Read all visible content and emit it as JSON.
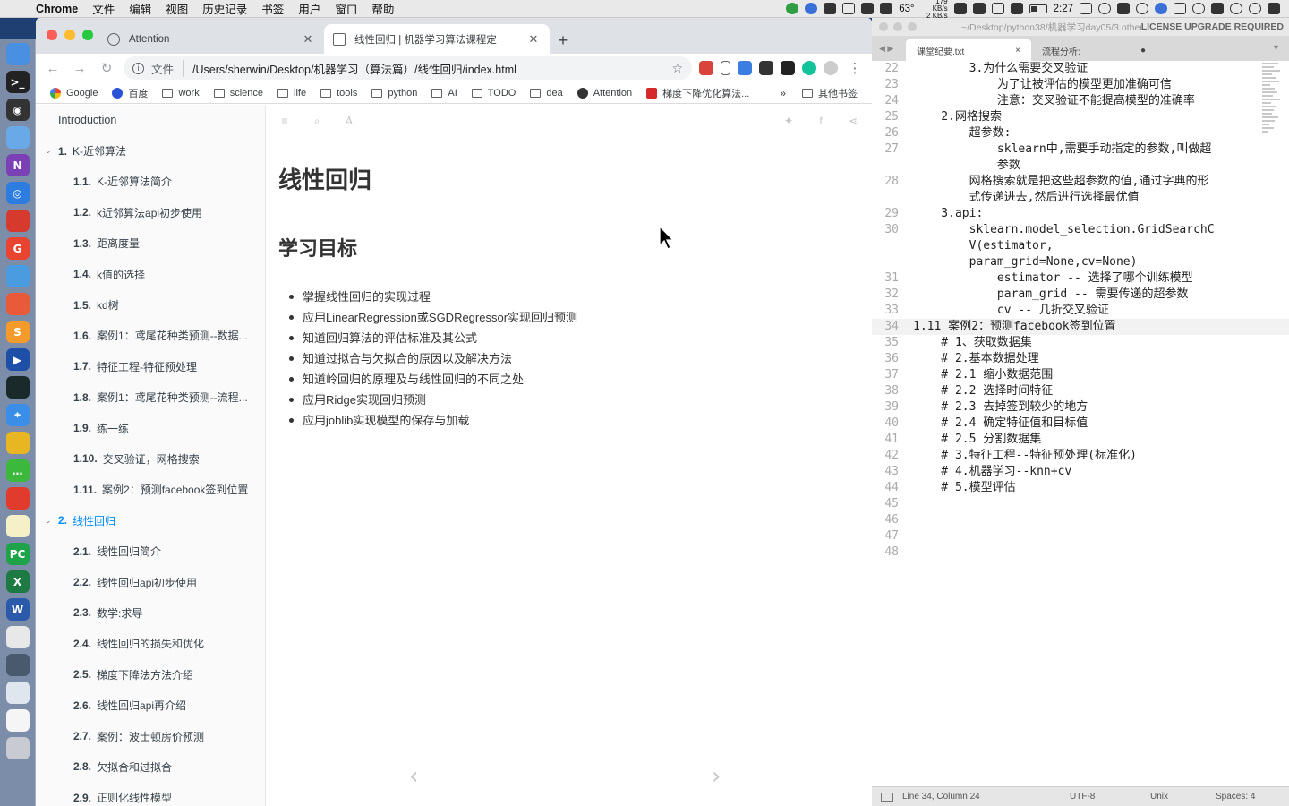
{
  "menubar": {
    "app_name": "Chrome",
    "items": [
      "文件",
      "编辑",
      "视图",
      "历史记录",
      "书签",
      "用户",
      "窗口",
      "帮助"
    ],
    "temperature": "63°",
    "net_up": "179 KB/s",
    "net_down": "2 KB/s",
    "clock": "2:27"
  },
  "chrome": {
    "tabs": [
      {
        "title": "Attention",
        "active": false
      },
      {
        "title": "线性回归 | 机器学习算法课程定",
        "active": true
      }
    ],
    "address": {
      "scheme_label": "文件",
      "url": "/Users/sherwin/Desktop/机器学习（算法篇）/线性回归/index.html"
    },
    "bookmarks": [
      "Google",
      "百度",
      "work",
      "science",
      "life",
      "tools",
      "python",
      "AI",
      "TODO",
      "dea",
      "Attention",
      "梯度下降优化算法..."
    ],
    "bookmarks_more": "»",
    "other_bookmarks": "其他书签"
  },
  "summary": {
    "intro": "Introduction",
    "chapters": [
      {
        "num": "1.",
        "title": "K-近邻算法",
        "active": false,
        "items": [
          {
            "num": "1.1.",
            "title": "K-近邻算法简介"
          },
          {
            "num": "1.2.",
            "title": "k近邻算法api初步使用"
          },
          {
            "num": "1.3.",
            "title": "距离度量"
          },
          {
            "num": "1.4.",
            "title": "k值的选择"
          },
          {
            "num": "1.5.",
            "title": "kd树"
          },
          {
            "num": "1.6.",
            "title": "案例1：鸢尾花种类预测--数据..."
          },
          {
            "num": "1.7.",
            "title": "特征工程-特征预处理"
          },
          {
            "num": "1.8.",
            "title": "案例1：鸢尾花种类预测--流程..."
          },
          {
            "num": "1.9.",
            "title": "练一练"
          },
          {
            "num": "1.10.",
            "title": "交叉验证，网格搜索"
          },
          {
            "num": "1.11.",
            "title": "案例2：预测facebook签到位置"
          }
        ]
      },
      {
        "num": "2.",
        "title": "线性回归",
        "active": true,
        "items": [
          {
            "num": "2.1.",
            "title": "线性回归简介"
          },
          {
            "num": "2.2.",
            "title": "线性回归api初步使用"
          },
          {
            "num": "2.3.",
            "title": "数学:求导"
          },
          {
            "num": "2.4.",
            "title": "线性回归的损失和优化"
          },
          {
            "num": "2.5.",
            "title": "梯度下降法方法介绍"
          },
          {
            "num": "2.6.",
            "title": "线性回归api再介绍"
          },
          {
            "num": "2.7.",
            "title": "案例：波士顿房价预测"
          },
          {
            "num": "2.8.",
            "title": "欠拟合和过拟合"
          },
          {
            "num": "2.9.",
            "title": "正则化线性模型"
          }
        ]
      }
    ]
  },
  "content": {
    "title": "线性回归",
    "section": "学习目标",
    "objectives": [
      "掌握线性回归的实现过程",
      "应用LinearRegression或SGDRegressor实现回归预测",
      "知道回归算法的评估标准及其公式",
      "知道过拟合与欠拟合的原因以及解决方法",
      "知道岭回归的原理及与线性回归的不同之处",
      "应用Ridge实现回归预测",
      "应用joblib实现模型的保存与加载"
    ],
    "prev_arrow": "‹",
    "next_arrow": "›"
  },
  "sublime": {
    "title_path": "~/Desktop/python38/机器学习day05/3.other",
    "license": "LICENSE UPGRADE REQUIRED",
    "tabs": [
      {
        "name": "课堂纪要.txt",
        "active": true,
        "close": "×"
      },
      {
        "name": "流程分析:",
        "active": false,
        "close": "●"
      }
    ],
    "lines": [
      {
        "n": "22",
        "t": "        3.为什么需要交叉验证"
      },
      {
        "n": "23",
        "t": "            为了让被评估的模型更加准确可信"
      },
      {
        "n": "24",
        "t": "            注意：交叉验证不能提高模型的准确率"
      },
      {
        "n": "25",
        "t": "    2.网格搜索"
      },
      {
        "n": "26",
        "t": "        超参数:"
      },
      {
        "n": "27",
        "t": "            sklearn中,需要手动指定的参数,叫做超"
      },
      {
        "n": "",
        "t": "            参数"
      },
      {
        "n": "28",
        "t": "        网格搜索就是把这些超参数的值,通过字典的形"
      },
      {
        "n": "",
        "t": "        式传递进去,然后进行选择最优值"
      },
      {
        "n": "29",
        "t": "    3.api:"
      },
      {
        "n": "30",
        "t": "        sklearn.model_selection.GridSearchC"
      },
      {
        "n": "",
        "t": "        V(estimator,"
      },
      {
        "n": "",
        "t": "        param_grid=None,cv=None)"
      },
      {
        "n": "31",
        "t": "            estimator -- 选择了哪个训练模型"
      },
      {
        "n": "32",
        "t": "            param_grid -- 需要传递的超参数"
      },
      {
        "n": "33",
        "t": "            cv -- 几折交叉验证"
      },
      {
        "n": "34",
        "t": "1.11 案例2：预测facebook签到位置"
      },
      {
        "n": "35",
        "t": "    # 1、获取数据集"
      },
      {
        "n": "36",
        "t": "    # 2.基本数据处理"
      },
      {
        "n": "37",
        "t": "    # 2.1 缩小数据范围"
      },
      {
        "n": "38",
        "t": "    # 2.2 选择时间特征"
      },
      {
        "n": "39",
        "t": "    # 2.3 去掉签到较少的地方"
      },
      {
        "n": "40",
        "t": "    # 2.4 确定特征值和目标值"
      },
      {
        "n": "41",
        "t": "    # 2.5 分割数据集"
      },
      {
        "n": "42",
        "t": "    # 3.特征工程--特征预处理(标准化)"
      },
      {
        "n": "43",
        "t": "    # 4.机器学习--knn+cv"
      },
      {
        "n": "44",
        "t": "    # 5.模型评估"
      },
      {
        "n": "45",
        "t": ""
      },
      {
        "n": "46",
        "t": ""
      },
      {
        "n": "47",
        "t": ""
      },
      {
        "n": "48",
        "t": ""
      }
    ],
    "highlight_line": "34",
    "status": {
      "position": "Line 34, Column 24",
      "encoding": "UTF-8",
      "line_endings": "Unix",
      "indent": "Spaces: 4"
    }
  },
  "dock": [
    {
      "name": "finder-icon",
      "color": "#4a90e2",
      "glyph": ""
    },
    {
      "name": "terminal-icon",
      "color": "#222222",
      "glyph": ">_"
    },
    {
      "name": "obs-icon",
      "color": "#333333",
      "glyph": "◉"
    },
    {
      "name": "preview-icon",
      "color": "#6aa9e8",
      "glyph": ""
    },
    {
      "name": "onenote-icon",
      "color": "#7b3fb6",
      "glyph": "N"
    },
    {
      "name": "alfred-icon",
      "color": "#2d7de0",
      "glyph": "◎"
    },
    {
      "name": "cloud-icon",
      "color": "#d63a2f",
      "glyph": ""
    },
    {
      "name": "grammarly-icon",
      "color": "#e8442f",
      "glyph": "G"
    },
    {
      "name": "pen-icon",
      "color": "#4a9be0",
      "glyph": ""
    },
    {
      "name": "screenshot-icon",
      "color": "#e85a3a",
      "glyph": ""
    },
    {
      "name": "sublime-icon",
      "color": "#f49a2a",
      "glyph": "S"
    },
    {
      "name": "quicktime-icon",
      "color": "#1e4fa8",
      "glyph": "▶"
    },
    {
      "name": "activity-monitor-icon",
      "color": "#1a2a2a",
      "glyph": ""
    },
    {
      "name": "safari-icon",
      "color": "#3b8ee8",
      "glyph": "⌖"
    },
    {
      "name": "chrome-icon",
      "color": "#e8b622",
      "glyph": ""
    },
    {
      "name": "wechat-icon",
      "color": "#3cb83c",
      "glyph": "…"
    },
    {
      "name": "weibo-icon",
      "color": "#e03b2d",
      "glyph": ""
    },
    {
      "name": "notes-icon",
      "color": "#f5f0c8",
      "glyph": ""
    },
    {
      "name": "pycharm-icon",
      "color": "#1fa34a",
      "glyph": "PC"
    },
    {
      "name": "excel-icon",
      "color": "#1d7a43",
      "glyph": "X"
    },
    {
      "name": "word-icon",
      "color": "#2b5aab",
      "glyph": "W"
    },
    {
      "name": "document-icon",
      "color": "#e8e8e8",
      "glyph": ""
    },
    {
      "name": "screen-icon",
      "color": "#4a5a6e",
      "glyph": ""
    },
    {
      "name": "window-icon",
      "color": "#e0e6ee",
      "glyph": ""
    },
    {
      "name": "file-icon",
      "color": "#f5f5f5",
      "glyph": ""
    },
    {
      "name": "trash-icon",
      "color": "#c8ccd2",
      "glyph": ""
    }
  ]
}
